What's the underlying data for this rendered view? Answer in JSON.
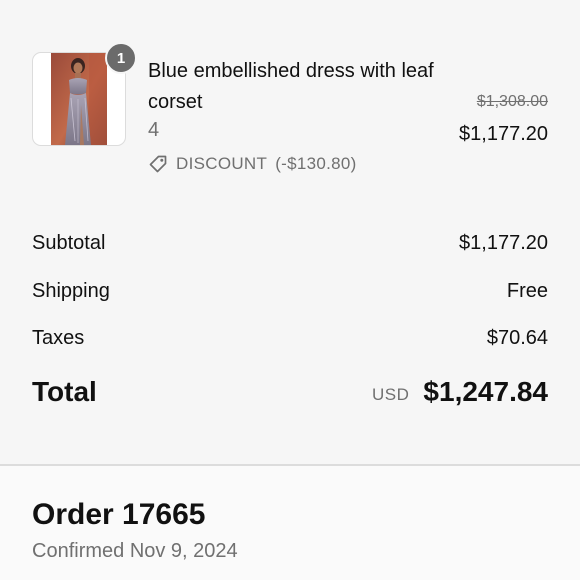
{
  "product": {
    "quantity_badge": "1",
    "name": "Blue embellished dress with leaf corset",
    "variant": "4",
    "discount_label": "DISCOUNT",
    "discount_amount": "(-$130.80)",
    "price_original": "$1,308.00",
    "price_final": "$1,177.20",
    "thumbnail_icon": "dress-photo"
  },
  "summary": {
    "rows": [
      {
        "label": "Subtotal",
        "value": "$1,177.20"
      },
      {
        "label": "Shipping",
        "value": "Free"
      },
      {
        "label": "Taxes",
        "value": "$70.64"
      }
    ],
    "total_label": "Total",
    "currency": "USD",
    "total_value": "$1,247.84"
  },
  "order": {
    "title": "Order 17665",
    "status": "Confirmed Nov 9, 2024"
  },
  "colors": {
    "background": "#f6f6f6",
    "muted_text": "#707070",
    "badge": "#6b6b6b"
  }
}
